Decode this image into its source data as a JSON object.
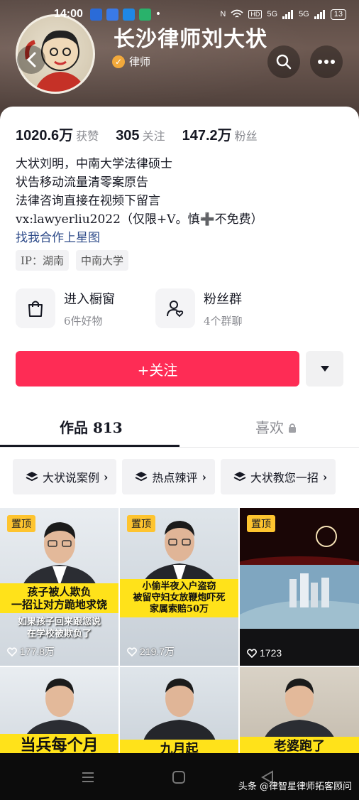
{
  "status_bar": {
    "time": "14:00",
    "network_label": "5G",
    "battery": "13"
  },
  "profile": {
    "name": "长沙律师刘大状",
    "badge_label": "律师",
    "stats": [
      {
        "value": "1020.6万",
        "label": "获赞"
      },
      {
        "value": "305",
        "label": "关注"
      },
      {
        "value": "147.2万",
        "label": "粉丝"
      }
    ],
    "bio_lines": [
      "大状刘明，中南大学法律硕士",
      "状告移动流量清零案原告",
      "法律咨询直接在视频下留言",
      "vx:lawyerliu2022（仅限+V。慎➕不免费）"
    ],
    "bio_link": "找我合作上星图",
    "tags": [
      "IP：湖南",
      "中南大学"
    ]
  },
  "features": [
    {
      "title": "进入橱窗",
      "subtitle": "6件好物",
      "icon": "shopping-bag-icon"
    },
    {
      "title": "粉丝群",
      "subtitle": "4个群聊",
      "icon": "fan-group-icon"
    }
  ],
  "actions": {
    "follow_label": "+关注"
  },
  "tabs": [
    {
      "label": "作品 813",
      "active": true
    },
    {
      "label": "喜欢",
      "active": false,
      "locked": true
    }
  ],
  "collections": [
    "大状说案例",
    "热点辣评",
    "大状教您一招"
  ],
  "videos": [
    {
      "pinned": "置顶",
      "caption": [
        "孩子被人欺负",
        "一招让对方跪地求饶"
      ],
      "subcaption": [
        "如果孩子回来跟您说",
        "在学校被欺负了"
      ],
      "likes": "177.8万"
    },
    {
      "pinned": "置顶",
      "caption": [
        "小偷半夜入户盗窃",
        "被留守妇女放鞭炮吓死",
        "家属索赔50万"
      ],
      "likes": "219.7万"
    },
    {
      "pinned": "置顶",
      "likes": "1723"
    },
    {
      "caption": [
        "当兵每个月"
      ]
    },
    {
      "caption": [
        "九月起"
      ]
    },
    {
      "caption": [
        "老婆跑了"
      ]
    }
  ],
  "watermark": "头条 @律智星律师拓客顾问",
  "colors": {
    "accent": "#fe2c55",
    "pin": "#fec42f",
    "caption_yellow": "#ffe21a"
  }
}
